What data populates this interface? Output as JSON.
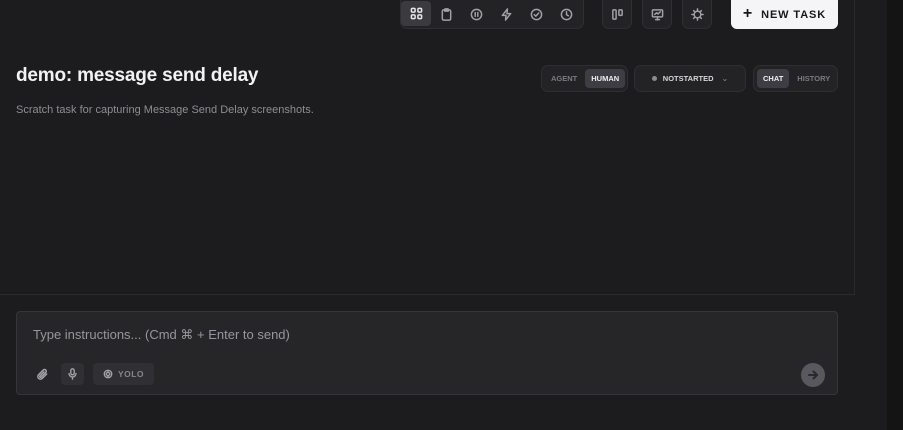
{
  "toolbar": {
    "views": [
      {
        "icon": "grid-icon",
        "active": true
      },
      {
        "icon": "clipboard-icon",
        "active": false
      },
      {
        "icon": "pause-circle-icon",
        "active": false
      },
      {
        "icon": "lightning-icon",
        "active": false
      },
      {
        "icon": "check-circle-icon",
        "active": false
      },
      {
        "icon": "clock-icon",
        "active": false
      }
    ],
    "tools": [
      "kanban-icon",
      "presentation-icon",
      "settings-gear-icon"
    ],
    "new_task": {
      "icon": "plus-icon",
      "label": "NEW TASK"
    }
  },
  "task": {
    "title": "demo: message send delay",
    "description": "Scratch task for capturing Message Send Delay screenshots."
  },
  "mode_toggle": {
    "options": [
      "AGENT",
      "HUMAN"
    ],
    "selected": "HUMAN"
  },
  "status": {
    "label": "NOTSTARTED",
    "dot_color": "#8b8b90"
  },
  "panel_toggle": {
    "options": [
      "CHAT",
      "HISTORY"
    ],
    "selected": "CHAT"
  },
  "composer": {
    "placeholder": "Type instructions... (Cmd ⌘ + Enter to send)",
    "value": "",
    "yolo_label": "YOLO"
  },
  "colors": {
    "accent": "#f5f5f7",
    "background": "#1c1c1e"
  }
}
